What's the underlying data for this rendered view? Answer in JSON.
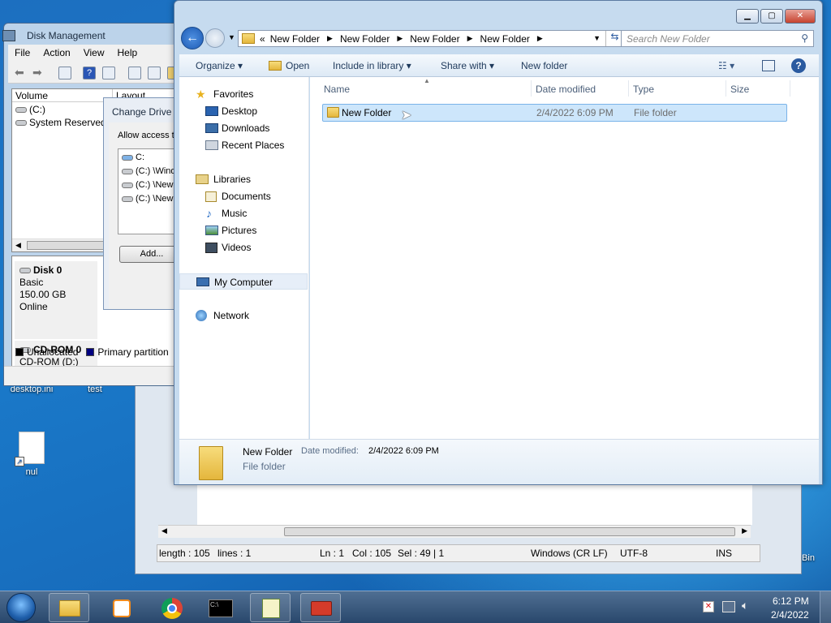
{
  "desktop": {
    "icons": [
      {
        "label": "desktop.ini"
      },
      {
        "label": "test"
      },
      {
        "label": "nul"
      },
      {
        "label": "Bin"
      }
    ]
  },
  "disk_management": {
    "title": "Disk Management",
    "menu": [
      "File",
      "Action",
      "View",
      "Help"
    ],
    "columns": [
      "Volume",
      "Layout"
    ],
    "volumes": [
      "(C:)",
      "System Reserved"
    ],
    "disk0": {
      "name": "Disk 0",
      "type": "Basic",
      "size": "150.00 GB",
      "status": "Online"
    },
    "cdrom": {
      "name": "CD-ROM 0",
      "drive": "CD-ROM (D:)"
    },
    "legend": {
      "unallocated": "Unallocated",
      "primary": "Primary partition"
    }
  },
  "change_drive_dialog": {
    "title": "Change Drive L",
    "allow_text": "Allow access to",
    "paths": [
      "C:",
      "(C:) \\Wind",
      "(C:) \\New",
      "(C:) \\New"
    ],
    "add_button": "Add..."
  },
  "notepad": {
    "status": {
      "length": "length : 105",
      "lines": "lines : 1",
      "ln": "Ln : 1",
      "col": "Col : 105",
      "sel": "Sel : 49 | 1",
      "eol": "Windows (CR LF)",
      "encoding": "UTF-8",
      "mode": "INS"
    }
  },
  "explorer": {
    "breadcrumb": [
      "«",
      "New Folder",
      "New Folder",
      "New Folder",
      "New Folder"
    ],
    "search_placeholder": "Search New Folder",
    "commands": {
      "organize": "Organize ▾",
      "open": "Open",
      "include": "Include in library ▾",
      "share": "Share with ▾",
      "new_folder": "New folder"
    },
    "nav": {
      "favorites": "Favorites",
      "desktop": "Desktop",
      "downloads": "Downloads",
      "recent": "Recent Places",
      "libraries": "Libraries",
      "documents": "Documents",
      "music": "Music",
      "pictures": "Pictures",
      "videos": "Videos",
      "computer": "My Computer",
      "network": "Network"
    },
    "columns": {
      "name": "Name",
      "date": "Date modified",
      "type": "Type",
      "size": "Size"
    },
    "rows": [
      {
        "name": "New Folder",
        "date": "2/4/2022 6:09 PM",
        "type": "File folder"
      }
    ],
    "details": {
      "name": "New Folder",
      "date_label": "Date modified:",
      "date": "2/4/2022 6:09 PM",
      "type": "File folder"
    }
  },
  "taskbar": {
    "time": "6:12 PM",
    "date": "2/4/2022"
  }
}
